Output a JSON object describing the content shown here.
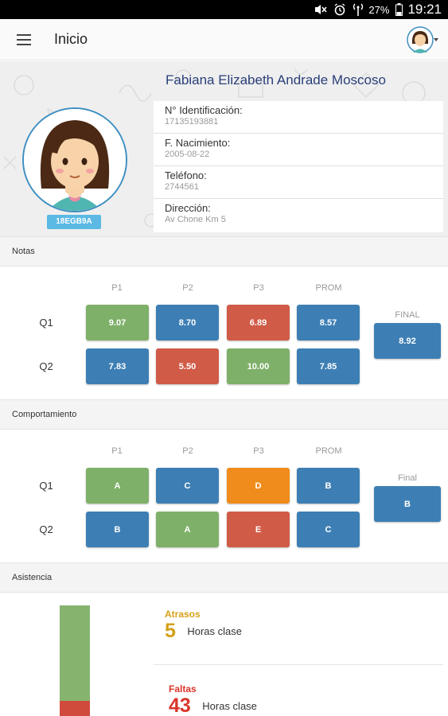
{
  "status_bar": {
    "battery": "27%",
    "time": "19:21"
  },
  "app_bar": {
    "title": "Inicio"
  },
  "profile": {
    "name": "Fabiana Elizabeth Andrade Moscoso",
    "code": "18EGB9A",
    "fields": [
      {
        "label": "N° Identificación:",
        "value": "17135193881"
      },
      {
        "label": "F. Nacimiento:",
        "value": "2005-08-22"
      },
      {
        "label": "Teléfono:",
        "value": "2744561"
      },
      {
        "label": "Dirección:",
        "value": "Av Chone Km 5"
      }
    ]
  },
  "colors": {
    "green": "#7fb069",
    "blue": "#3d7fb4",
    "red": "#d05b47",
    "orange": "#f08c1c",
    "title_blue": "#2a3f7a",
    "atrasos": "#d4a017",
    "faltas": "#d9362b"
  },
  "notas": {
    "section_title": "Notas",
    "columns": [
      "P1",
      "P2",
      "P3",
      "PROM"
    ],
    "rows": [
      {
        "label": "Q1",
        "values": [
          "9.07",
          "8.70",
          "6.89",
          "8.57"
        ],
        "colors": [
          "green",
          "blue",
          "red",
          "blue"
        ]
      },
      {
        "label": "Q2",
        "values": [
          "7.83",
          "5.50",
          "10.00",
          "7.85"
        ],
        "colors": [
          "blue",
          "red",
          "green",
          "blue"
        ]
      }
    ],
    "final_label": "FINAL",
    "final_value": "8.92"
  },
  "comportamiento": {
    "section_title": "Comportamiento",
    "columns": [
      "P1",
      "P2",
      "P3",
      "PROM"
    ],
    "rows": [
      {
        "label": "Q1",
        "values": [
          "A",
          "C",
          "D",
          "B"
        ],
        "colors": [
          "green",
          "blue",
          "orange",
          "blue"
        ]
      },
      {
        "label": "Q2",
        "values": [
          "B",
          "A",
          "E",
          "C"
        ],
        "colors": [
          "blue",
          "green",
          "red",
          "blue"
        ]
      }
    ],
    "final_label": "Final",
    "final_value": "B"
  },
  "asistencia": {
    "section_title": "Asistencia",
    "atrasos": {
      "label": "Atrasos",
      "count": "5",
      "unit": "Horas clase"
    },
    "faltas": {
      "label": "Faltas",
      "count": "43",
      "unit": "Horas clase"
    }
  }
}
